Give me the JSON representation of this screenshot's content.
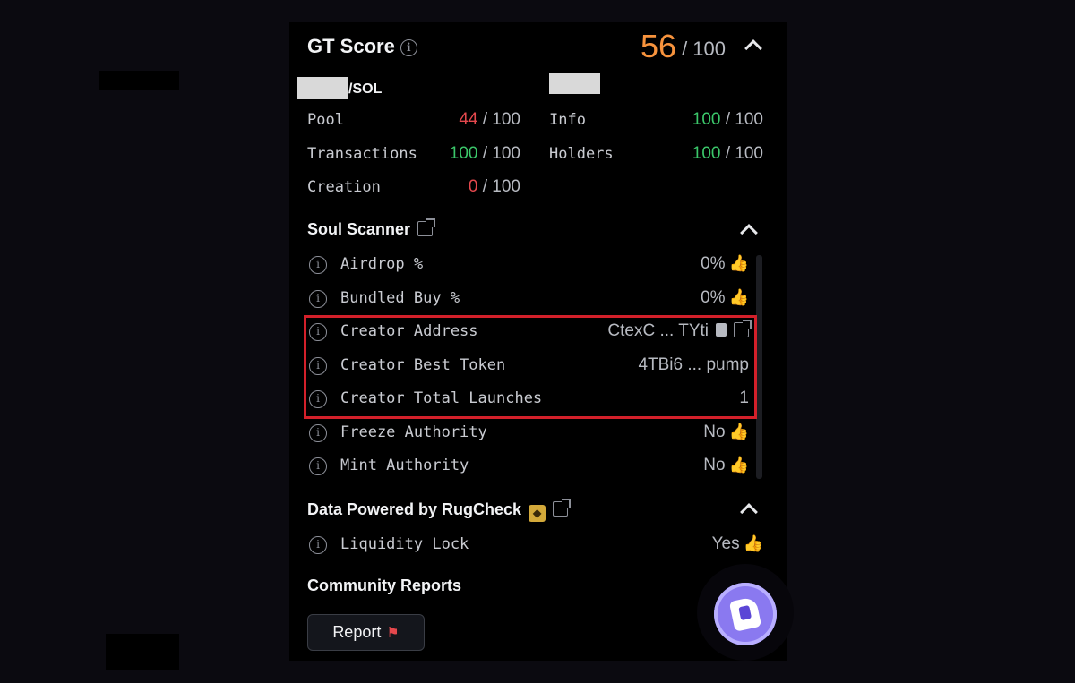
{
  "gt_score": {
    "title": "GT Score",
    "score": "56",
    "max": "/ 100"
  },
  "pair": {
    "quote": "/SOL"
  },
  "metrics": [
    {
      "label": "Pool",
      "value": "44",
      "max": " / 100",
      "color": "#e5484d"
    },
    {
      "label": "Info",
      "value": "100",
      "max": " / 100",
      "color": "#3bc76a"
    },
    {
      "label": "Transactions",
      "value": "100",
      "max": " / 100",
      "color": "#3bc76a"
    },
    {
      "label": "Holders",
      "value": "100",
      "max": " / 100",
      "color": "#3bc76a"
    },
    {
      "label": "Creation",
      "value": "0",
      "max": " / 100",
      "color": "#e5484d"
    }
  ],
  "soul_scanner": {
    "title": "Soul Scanner",
    "rows": [
      {
        "label": "Airdrop %",
        "value": "0%"
      },
      {
        "label": "Bundled Buy %",
        "value": "0%"
      },
      {
        "label": "Creator Address",
        "value": "CtexC ... TYti"
      },
      {
        "label": "Creator Best Token",
        "value": "4TBi6 ... pump"
      },
      {
        "label": "Creator Total Launches",
        "value": "1"
      },
      {
        "label": "Freeze Authority",
        "value": "No"
      },
      {
        "label": "Mint Authority",
        "value": "No"
      }
    ]
  },
  "rugcheck": {
    "title": "Data Powered by RugCheck",
    "rows": [
      {
        "label": "Liquidity Lock",
        "value": "Yes"
      }
    ]
  },
  "community": {
    "title": "Community Reports",
    "report_label": "Report"
  }
}
